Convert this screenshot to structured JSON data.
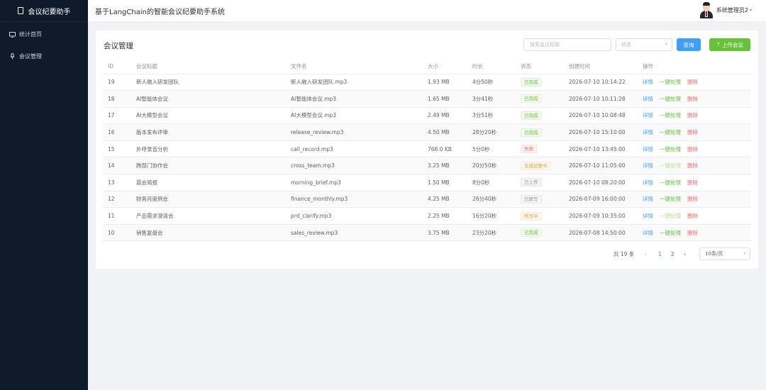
{
  "app": {
    "brand": "会议纪要助手",
    "header_title": "基于LangChain的智能会议纪要助手系统",
    "user_name": "系统管理员2"
  },
  "sidebar": {
    "items": [
      {
        "label": "统计首页",
        "icon": "monitor-icon"
      },
      {
        "label": "会议管理",
        "icon": "microphone-icon"
      }
    ]
  },
  "main": {
    "card_title": "会议管理",
    "search_placeholder": "搜索会议标题",
    "status_placeholder": "状态",
    "query_label": "查询",
    "upload_label": "上传会议",
    "columns": [
      "ID",
      "会议标题",
      "文件名",
      "大小",
      "时长",
      "状态",
      "创建时间",
      "操作"
    ],
    "actions": {
      "detail": "详情",
      "process": "一键处理",
      "delete": "删除"
    },
    "rows": [
      {
        "id": "19",
        "title": "新人融入研发团队",
        "file": "新人融入研发团队.mp3",
        "size": "1.93 MB",
        "duration": "4分50秒",
        "status": "已完成",
        "status_type": "success",
        "created": "2026-07-10 10:14:22"
      },
      {
        "id": "18",
        "title": "AI智能体会议",
        "file": "AI智能体会议.mp3",
        "size": "1.65 MB",
        "duration": "3分41秒",
        "status": "已完成",
        "status_type": "success",
        "created": "2026-07-10 10:11:28"
      },
      {
        "id": "17",
        "title": "AI大模型会议",
        "file": "AI大模型会议.mp3",
        "size": "2.49 MB",
        "duration": "3分51秒",
        "status": "已完成",
        "status_type": "success",
        "created": "2026-07-10 10:08:48"
      },
      {
        "id": "16",
        "title": "版本发布评审",
        "file": "release_review.mp3",
        "size": "4.50 MB",
        "duration": "28分20秒",
        "status": "已完成",
        "status_type": "success",
        "created": "2026-07-10 15:10:00"
      },
      {
        "id": "15",
        "title": "外呼录音分析",
        "file": "call_record.mp3",
        "size": "768.0 KB",
        "duration": "5分0秒",
        "status": "失败",
        "status_type": "danger",
        "created": "2026-07-10 13:45:00"
      },
      {
        "id": "14",
        "title": "跨部门协作会",
        "file": "cross_team.mp3",
        "size": "3.25 MB",
        "duration": "20分50秒",
        "status": "生成纪要中",
        "status_type": "warning",
        "created": "2026-07-10 11:05:00"
      },
      {
        "id": "13",
        "title": "晨会简报",
        "file": "morning_brief.mp3",
        "size": "1.50 MB",
        "duration": "8分0秒",
        "status": "已上传",
        "status_type": "info",
        "created": "2026-07-10 08:20:00"
      },
      {
        "id": "12",
        "title": "财务月度例会",
        "file": "finance_monthly.mp3",
        "size": "4.25 MB",
        "duration": "26分40秒",
        "status": "已转写",
        "status_type": "info",
        "created": "2026-07-09 16:00:00"
      },
      {
        "id": "11",
        "title": "产品需求澄清会",
        "file": "prd_clarify.mp3",
        "size": "2.25 MB",
        "duration": "16分20秒",
        "status": "转写中",
        "status_type": "warning",
        "created": "2026-07-09 10:35:00"
      },
      {
        "id": "10",
        "title": "销售复盘会",
        "file": "sales_review.mp3",
        "size": "3.75 MB",
        "duration": "23分20秒",
        "status": "已完成",
        "status_type": "success",
        "created": "2026-07-08 14:50:00"
      }
    ]
  },
  "pagination": {
    "total_text": "共 19 条",
    "pages": [
      "1",
      "2"
    ],
    "current": "1",
    "page_size": "10条/页"
  }
}
